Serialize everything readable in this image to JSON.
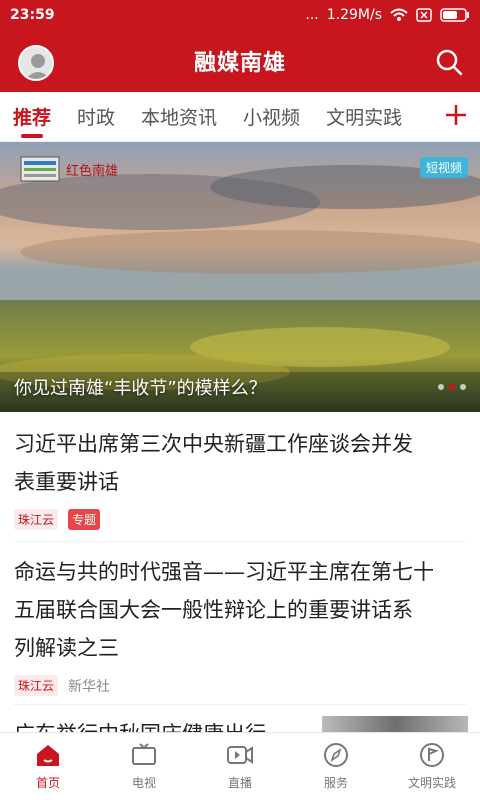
{
  "status": {
    "time": "23:59",
    "network": "1.29M/s",
    "signal_dots": "..."
  },
  "header": {
    "title": "融媒南雄"
  },
  "tabs": [
    {
      "label": "推荐"
    },
    {
      "label": "时政"
    },
    {
      "label": "本地资讯"
    },
    {
      "label": "小视频"
    },
    {
      "label": "文明实践"
    }
  ],
  "hero": {
    "badge": "短视频",
    "logo_text": "红色南雄",
    "caption": "你见过南雄“丰收节”的模样么？"
  },
  "articles": [
    {
      "headline_line1": "习近平出席第三次中央新疆工作座谈会并发",
      "headline_line2": "表重要讲话",
      "source": "珠江云",
      "topic": "专题"
    },
    {
      "headline_line1": "命运与共的时代强音——习近平主席在第七十",
      "headline_line2": "五届联合国大会一般性辩论上的重要讲话系",
      "headline_line3": "列解读之三",
      "source": "珠江云",
      "origin": "新华社"
    }
  ],
  "partial_article": "广东举行中秋国庆健康出行",
  "tabbar": [
    {
      "label": "首页",
      "icon": "home-icon"
    },
    {
      "label": "电视",
      "icon": "tv-icon"
    },
    {
      "label": "直播",
      "icon": "live-icon"
    },
    {
      "label": "服务",
      "icon": "compass-icon"
    },
    {
      "label": "文明实践",
      "icon": "flag-icon"
    }
  ],
  "colors": {
    "brand": "#c8161e",
    "badge": "#3fb6d9"
  }
}
